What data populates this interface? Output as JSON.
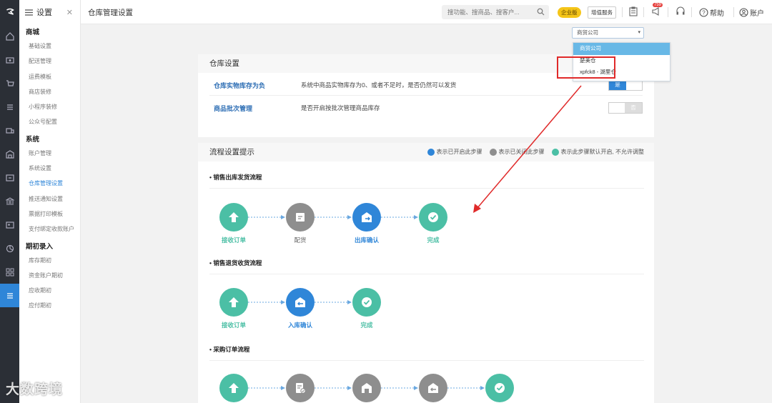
{
  "top": {
    "page_title": "仓库管理设置",
    "search_placeholder": "搜功能、搜商品、搜客户...",
    "enterprise_badge": "企业版",
    "value_added": "增值服务",
    "notif_count": "759",
    "help": "帮助",
    "account": "账户"
  },
  "sidebar": {
    "title": "设置",
    "groups": [
      {
        "name": "商城",
        "items": [
          "基础设置",
          "配送管理",
          "运费模板",
          "商店装修",
          "小程序装修",
          "公众号配置"
        ]
      },
      {
        "name": "系统",
        "items": [
          "账户管理",
          "系统设置",
          "仓库管理设置",
          "推送通知设置",
          "票据打印模板",
          "支付绑定收款账户"
        ]
      },
      {
        "name": "期初录入",
        "items": [
          "库存期初",
          "资金账户期初",
          "应收期初",
          "应付期初"
        ]
      }
    ],
    "active_item": "仓库管理设置"
  },
  "company_select": {
    "value": "商贸公司",
    "options": [
      "商贸公司",
      "楚美仓",
      "xpfck8 - 湖里仓"
    ]
  },
  "warehouse": {
    "title": "仓库设置",
    "rows": [
      {
        "label": "仓库实物库存为负",
        "desc": "系统中商品实物库存为0、或者不足时，是否仍然可以发货",
        "state": "on",
        "on_label": "是",
        "off_label": "否"
      },
      {
        "label": "商品批次管理",
        "desc": "是否开启按批次管理商品库存",
        "state": "off",
        "on_label": "是",
        "off_label": "否"
      }
    ]
  },
  "flow_hint": {
    "title": "流程设置提示",
    "legend": [
      {
        "text": "表示已开启此步骤",
        "color": "#2f86d8"
      },
      {
        "text": "表示已关闭此步骤",
        "color": "#8e8e8e"
      },
      {
        "text": "表示此步骤默认开启, 不允许调整",
        "color": "#4bbfa5"
      }
    ],
    "sections": [
      {
        "title": "• 销售出库发货流程",
        "steps": [
          {
            "label": "接收订单",
            "color": "teal",
            "icon": "arrow-up-icon"
          },
          {
            "label": "配货",
            "color": "gray",
            "icon": "box-icon"
          },
          {
            "label": "出库确认",
            "color": "blue",
            "icon": "warehouse-out-icon"
          },
          {
            "label": "完成",
            "color": "teal",
            "icon": "check-icon"
          }
        ]
      },
      {
        "title": "• 销售退货收货流程",
        "steps": [
          {
            "label": "接收订单",
            "color": "teal",
            "icon": "arrow-up-icon"
          },
          {
            "label": "入库确认",
            "color": "blue",
            "icon": "warehouse-in-icon"
          },
          {
            "label": "完成",
            "color": "teal",
            "icon": "check-icon"
          }
        ]
      },
      {
        "title": "• 采购订单流程",
        "steps": [
          {
            "label": "",
            "color": "teal",
            "icon": "arrow-up-icon"
          },
          {
            "label": "",
            "color": "gray",
            "icon": "document-check-icon"
          },
          {
            "label": "",
            "color": "gray",
            "icon": "warehouse-icon"
          },
          {
            "label": "",
            "color": "gray",
            "icon": "warehouse-in-icon"
          },
          {
            "label": "",
            "color": "teal",
            "icon": "check-icon"
          }
        ]
      }
    ]
  },
  "watermark": "大数跨境"
}
